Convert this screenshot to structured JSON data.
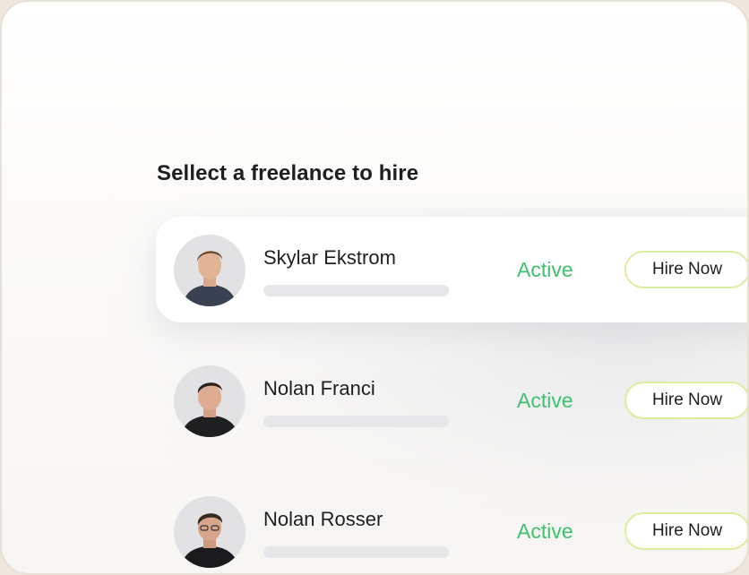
{
  "heading": "Sellect a freelance to hire",
  "colors": {
    "status_active": "#3ec26f",
    "button_border": "#d9ef9f",
    "selected_row_bg": "#ffffff"
  },
  "freelancers": [
    {
      "name": "Skylar Ekstrom",
      "status": "Active",
      "button": "Hire Now",
      "avatar": "person-avatar",
      "selected": true
    },
    {
      "name": "Nolan Franci",
      "status": "Active",
      "button": "Hire Now",
      "avatar": "person-avatar",
      "selected": false
    },
    {
      "name": "Nolan Rosser",
      "status": "Active",
      "button": "Hire Now",
      "avatar": "person-avatar",
      "selected": false
    }
  ]
}
